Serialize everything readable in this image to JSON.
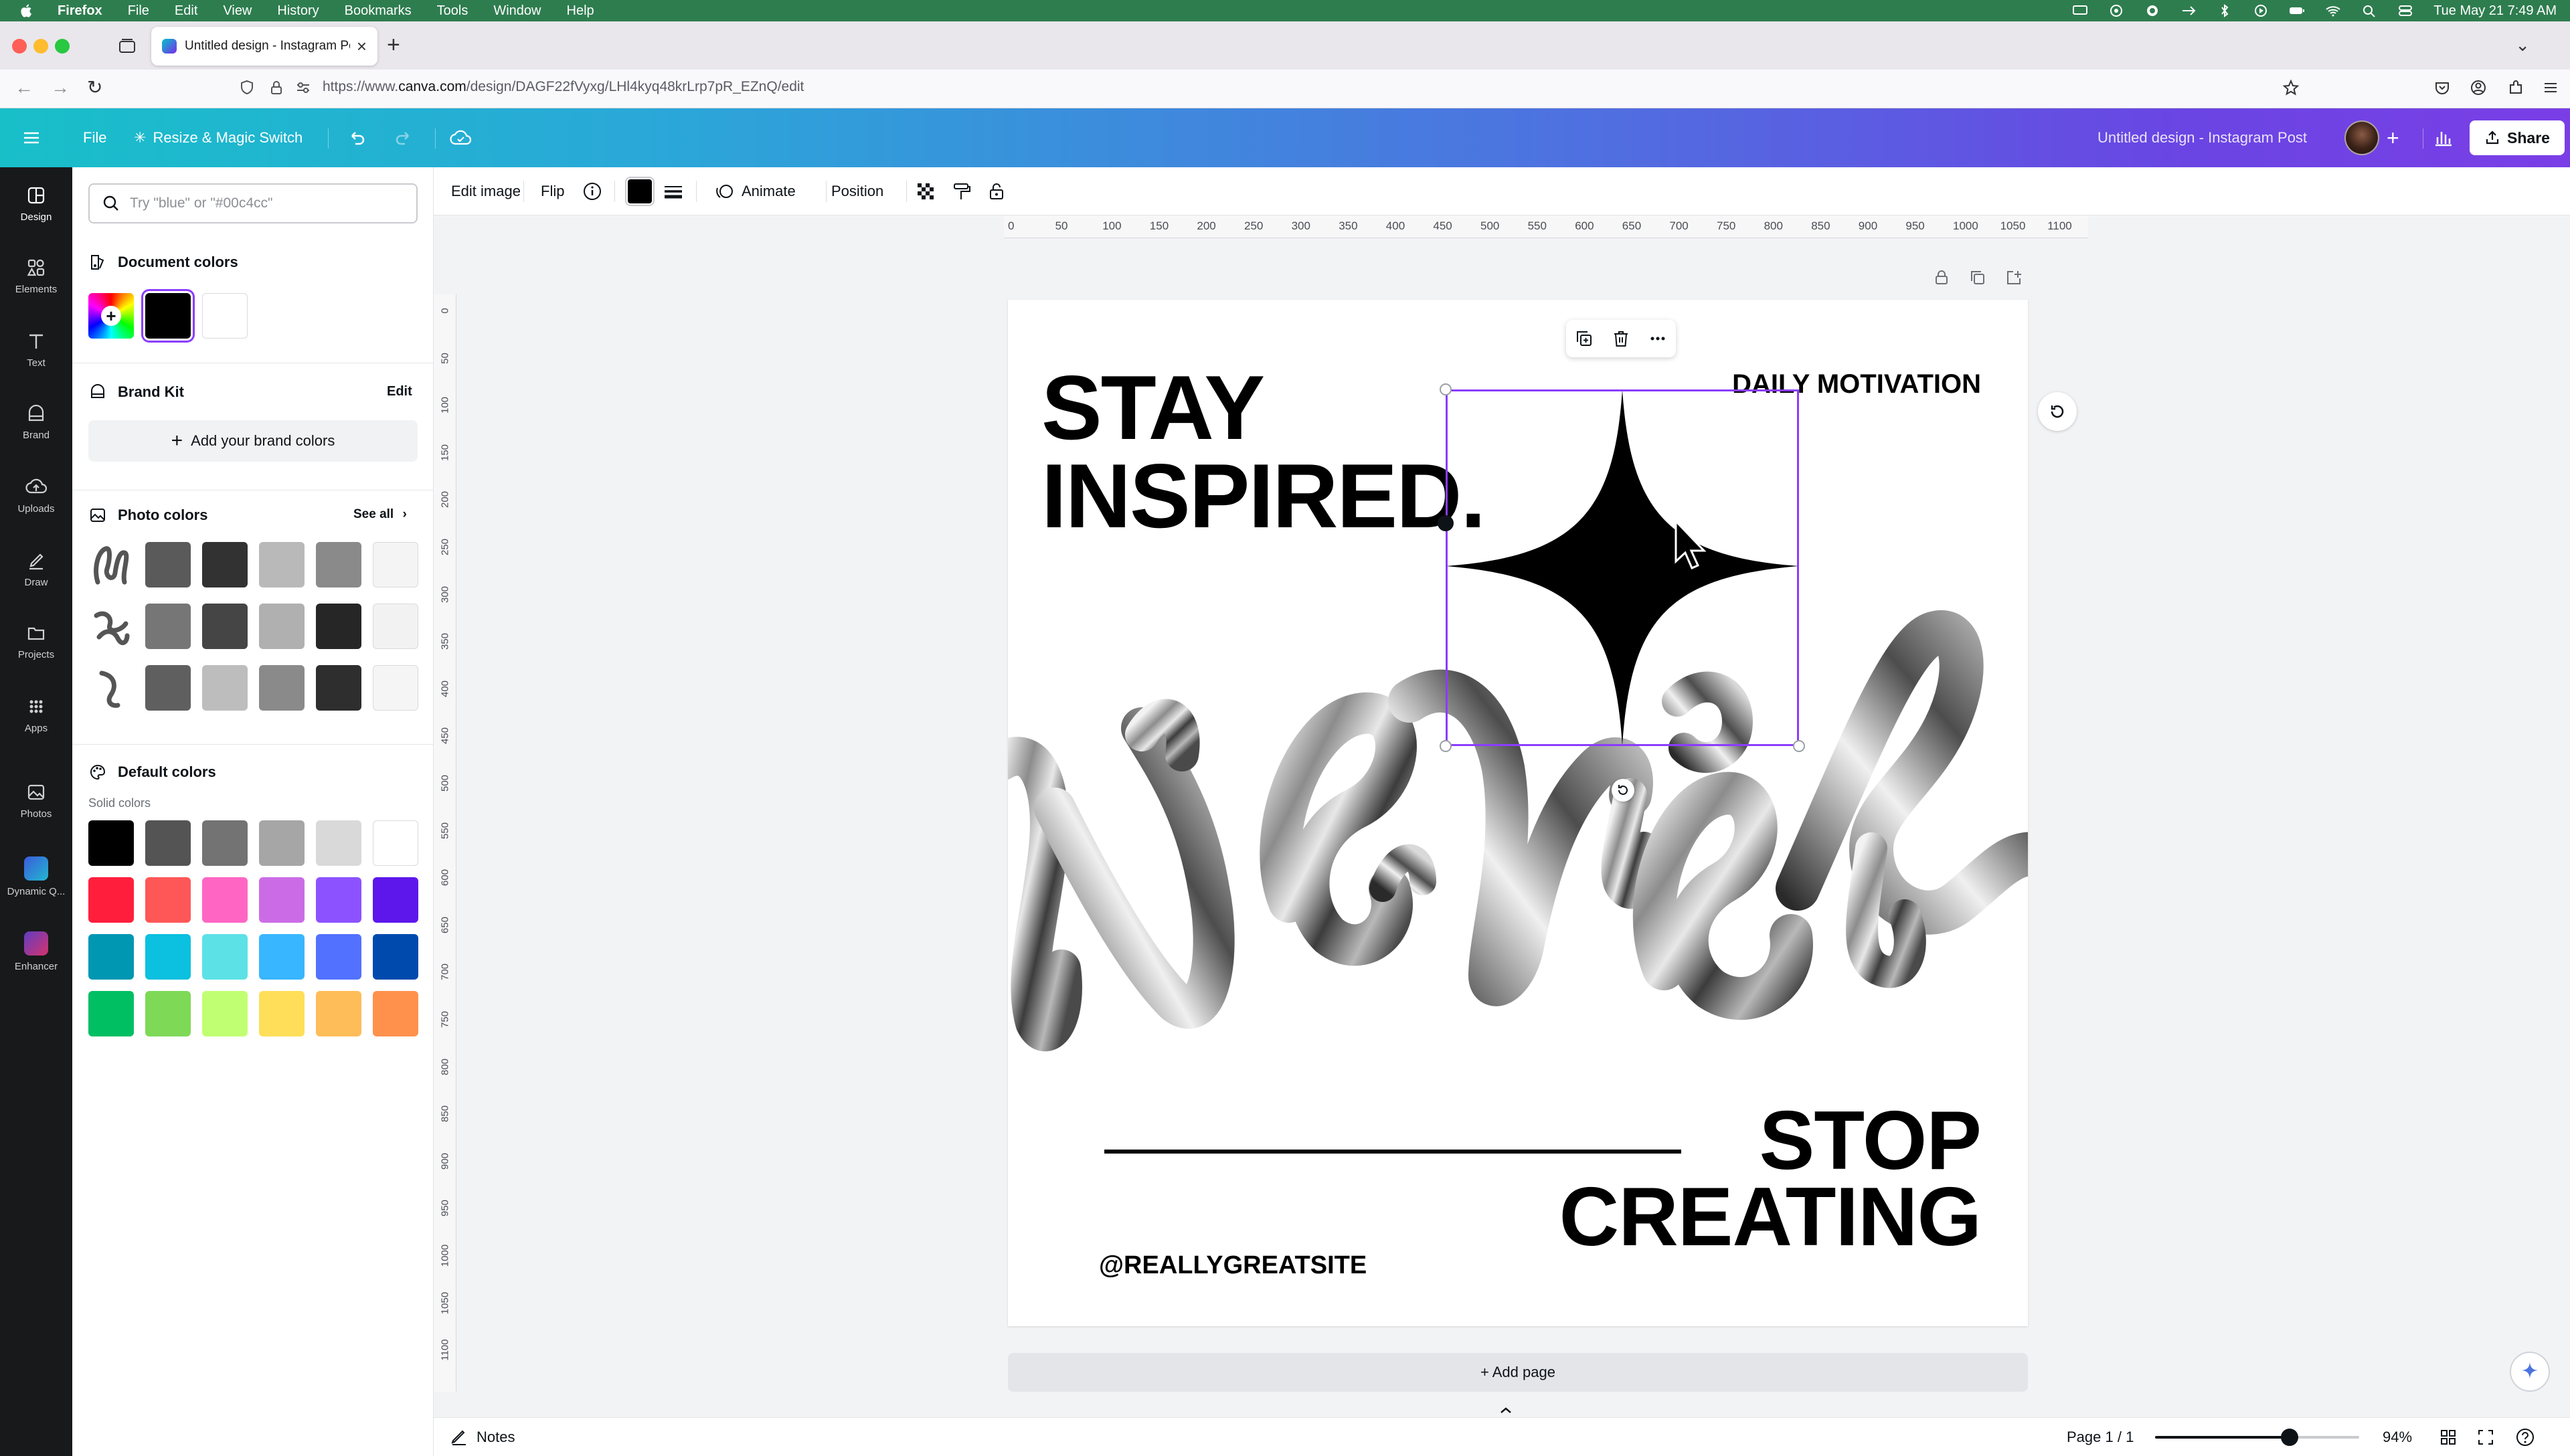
{
  "menubar": {
    "items": [
      "Firefox",
      "File",
      "Edit",
      "View",
      "History",
      "Bookmarks",
      "Tools",
      "Window",
      "Help"
    ],
    "clock": "Tue May 21  7:49 AM"
  },
  "browser": {
    "tab_title": "Untitled design - Instagram Po",
    "url_prefix": "https://www.",
    "url_domain": "canva.com",
    "url_path": "/design/DAGF22fVyxg/LHl4kyq48krLrp7pR_EZnQ/edit"
  },
  "canva_header": {
    "file": "File",
    "resize": "Resize & Magic Switch",
    "doc_title": "Untitled design - Instagram Post",
    "share": "Share"
  },
  "rail": [
    {
      "label": "Design",
      "icon": "design-icon"
    },
    {
      "label": "Elements",
      "icon": "elements-icon"
    },
    {
      "label": "Text",
      "icon": "text-icon"
    },
    {
      "label": "Brand",
      "icon": "brand-icon"
    },
    {
      "label": "Uploads",
      "icon": "uploads-icon"
    },
    {
      "label": "Draw",
      "icon": "draw-icon"
    },
    {
      "label": "Projects",
      "icon": "projects-icon"
    },
    {
      "label": "Apps",
      "icon": "apps-icon"
    },
    {
      "label": "Photos",
      "icon": "photos-icon"
    },
    {
      "label": "Dynamic Q...",
      "icon": "dynamic-qr-icon"
    },
    {
      "label": "Enhancer",
      "icon": "enhancer-icon"
    }
  ],
  "panel": {
    "search_placeholder": "Try \"blue\" or \"#00c4cc\"",
    "document_colors_title": "Document colors",
    "document_colors": [
      "#000000",
      "#ffffff"
    ],
    "brand_kit_title": "Brand Kit",
    "brand_kit_edit": "Edit",
    "add_brand_colors": "Add your brand colors",
    "photo_colors_title": "Photo colors",
    "see_all": "See all",
    "photo_color_rows": [
      [
        "#5a5a5a",
        "#323232",
        "#b9b9b9",
        "#8a8a8a",
        "#f4f4f4"
      ],
      [
        "#767676",
        "#454545",
        "#b0b0b0",
        "#262626",
        "#f2f2f2"
      ],
      [
        "#5f5f5f",
        "#bdbdbd",
        "#8a8a8a",
        "#2e2e2e",
        "#f5f5f5"
      ]
    ],
    "default_colors_title": "Default colors",
    "solid_colors_label": "Solid colors",
    "solid_colors": [
      [
        "#000000",
        "#545454",
        "#737373",
        "#a6a6a6",
        "#d9d9d9",
        "#ffffff"
      ],
      [
        "#ff1f3d",
        "#ff5757",
        "#ff66c4",
        "#cb6ce6",
        "#8c52ff",
        "#5e17eb"
      ],
      [
        "#0097b2",
        "#0cc0df",
        "#5ce1e6",
        "#38b6ff",
        "#5271ff",
        "#004aad"
      ],
      [
        "#00bf63",
        "#7ed957",
        "#c1ff72",
        "#ffde59",
        "#ffbd59",
        "#ff914d"
      ]
    ]
  },
  "context_toolbar": {
    "edit_image": "Edit image",
    "flip": "Flip",
    "fill_color": "#000000",
    "animate": "Animate",
    "position": "Position"
  },
  "ruler": {
    "top": [
      "0",
      "50",
      "100",
      "150",
      "200",
      "250",
      "300",
      "350",
      "400",
      "450",
      "500",
      "550",
      "600",
      "650",
      "700",
      "750",
      "800",
      "850",
      "900",
      "950",
      "1000",
      "1050",
      "1100"
    ],
    "left": [
      "0",
      "50",
      "100",
      "150",
      "200",
      "250",
      "300",
      "350",
      "400",
      "450",
      "500",
      "550",
      "600",
      "650",
      "700",
      "750",
      "800",
      "850",
      "900",
      "950",
      "1000",
      "1050",
      "1100"
    ]
  },
  "design": {
    "headline_line1": "STAY",
    "headline_line2": "INSPIRED.",
    "tag": "DAILY MOTIVATION",
    "closing_line1": "STOP",
    "closing_line2": "CREATING",
    "handle": "@REALLYGREATSITE",
    "graphic": "chrome-never-lettering",
    "selected_element": "four-point-star"
  },
  "canvas": {
    "add_page": "+ Add page"
  },
  "footer": {
    "notes": "Notes",
    "page_indicator": "Page 1 / 1",
    "zoom": "94%",
    "zoom_fraction": 0.66
  }
}
